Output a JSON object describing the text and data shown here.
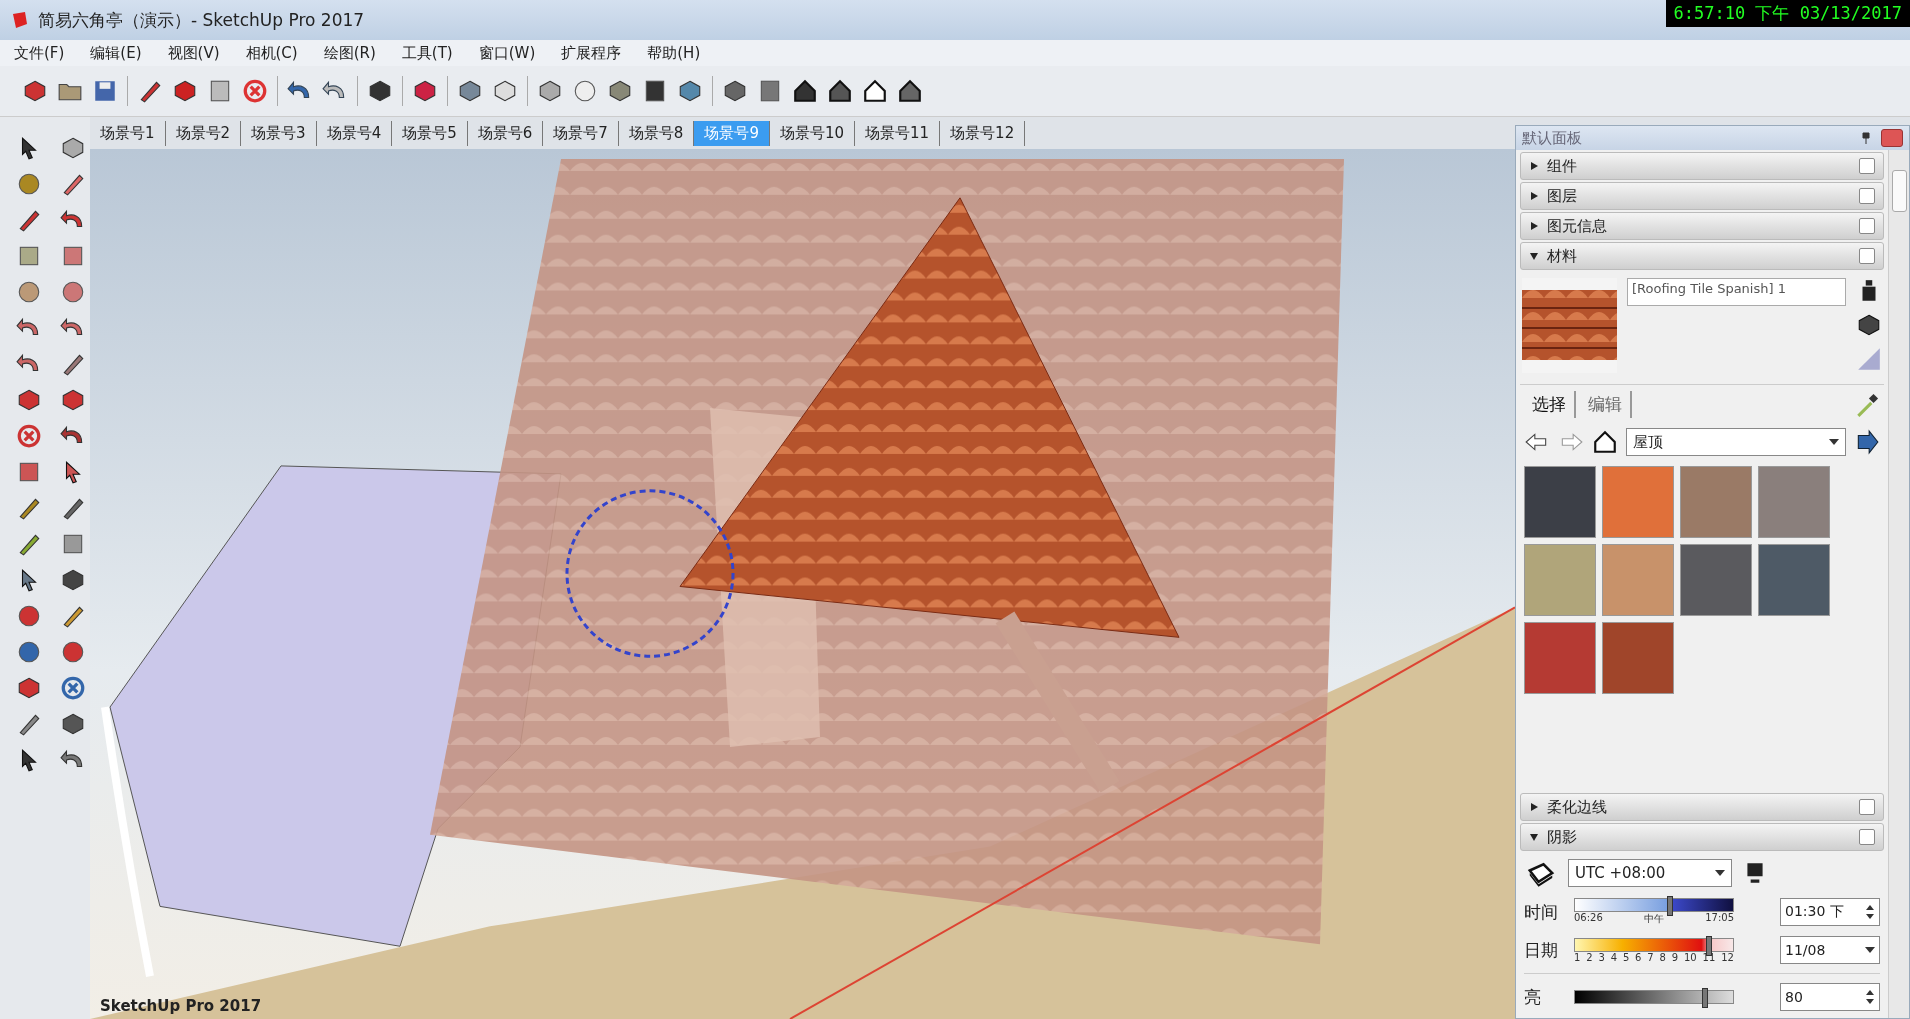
{
  "window": {
    "title": "简易六角亭（演示）- SketchUp Pro 2017"
  },
  "clock": "6:57:10 下午 03/13/2017",
  "menu": [
    "文件(F)",
    "编辑(E)",
    "视图(V)",
    "相机(C)",
    "绘图(R)",
    "工具(T)",
    "窗口(W)",
    "扩展程序",
    "帮助(H)"
  ],
  "scenes": [
    {
      "label": "场景号1",
      "selected": false
    },
    {
      "label": "场景号2",
      "selected": false
    },
    {
      "label": "场景号3",
      "selected": false
    },
    {
      "label": "场景号4",
      "selected": false
    },
    {
      "label": "场景号5",
      "selected": false
    },
    {
      "label": "场景号6",
      "selected": false
    },
    {
      "label": "场景号7",
      "selected": false
    },
    {
      "label": "场景号8",
      "selected": false
    },
    {
      "label": "场景号9",
      "selected": true
    },
    {
      "label": "场景号10",
      "selected": false
    },
    {
      "label": "场景号11",
      "selected": false
    },
    {
      "label": "场景号12",
      "selected": false
    }
  ],
  "viewport": {
    "watermark": "SketchUp Pro 2017"
  },
  "tray": {
    "title": "默认面板",
    "sections_top": [
      {
        "label": "组件",
        "expanded": false
      },
      {
        "label": "图层",
        "expanded": false
      },
      {
        "label": "图元信息",
        "expanded": false
      },
      {
        "label": "材料",
        "expanded": true
      }
    ],
    "materials": {
      "name": "[Roofing Tile Spanish] 1",
      "tabs": [
        {
          "label": "选择",
          "selected": true
        },
        {
          "label": "编辑",
          "selected": false
        }
      ],
      "library": "屋顶",
      "swatches": [
        {
          "color": "#3c3f47"
        },
        {
          "color": "#e0703a"
        },
        {
          "color": "#9a7a66"
        },
        {
          "color": "#8a7f7c"
        },
        {
          "color": "#b0a57a"
        },
        {
          "color": "#c8926a"
        },
        {
          "color": "#5a5a5e"
        },
        {
          "color": "#4e5a66"
        },
        {
          "color": "#b53a33"
        },
        {
          "color": "#a0452a"
        }
      ]
    },
    "sections_bottom": [
      {
        "label": "柔化边线",
        "expanded": false
      },
      {
        "label": "阴影",
        "expanded": true
      }
    ],
    "shadows": {
      "timezone": "UTC +08:00",
      "time_label": "时间",
      "time_ticks": [
        "06:26",
        "中午",
        "17:05"
      ],
      "time": {
        "level": 0.6
      },
      "time_value": "01:30 下",
      "date_label": "日期",
      "months": [
        "1",
        "2",
        "3",
        "4",
        "5",
        "6",
        "7",
        "8",
        "9",
        "10",
        "11",
        "12"
      ],
      "date": {
        "level": 0.85
      },
      "date_value": "11/08",
      "light_label": "亮",
      "light": {
        "level": 0.82
      },
      "light_value": "80"
    }
  }
}
